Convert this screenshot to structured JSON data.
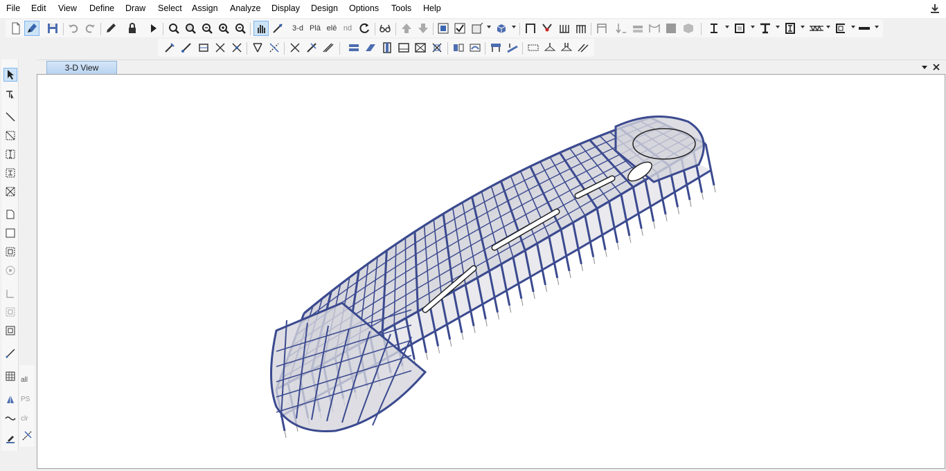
{
  "menu": [
    "File",
    "Edit",
    "View",
    "Define",
    "Draw",
    "Select",
    "Assign",
    "Analyze",
    "Display",
    "Design",
    "Options",
    "Tools",
    "Help"
  ],
  "toolbar1_text": {
    "view_3d": "3-d",
    "plan": "Plā",
    "elev": "elē",
    "nd": "nd"
  },
  "side_text": {
    "all": "all",
    "ps": "PS",
    "clr": "clr"
  },
  "view": {
    "tab_title": "3-D View"
  },
  "colors": {
    "frame": "#3b4a8f",
    "slab": "#c8c8d2",
    "accent": "#cde4f7"
  }
}
